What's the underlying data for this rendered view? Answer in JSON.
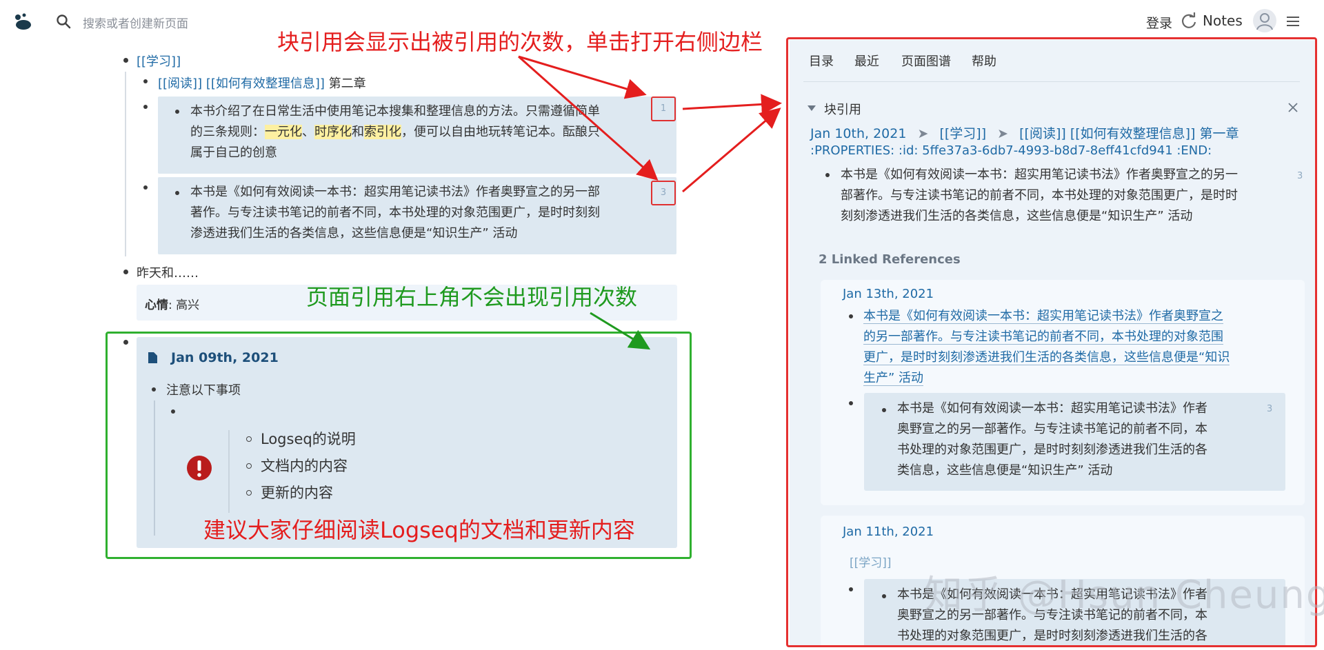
{
  "header": {
    "search_placeholder": "搜索或者创建新页面",
    "login_label": "登录",
    "notes_label": "Notes"
  },
  "main": {
    "study_link": "[[学习]]",
    "reading_link": "[[阅读]]",
    "manage_link": "[[如何有效整理信息]]",
    "chapter2": "第二章",
    "block1_line1": "本书介绍了在日常生活中使用笔记本搜集和整理信息的方法。只需遵循简单",
    "block1_line2_a": "的三条规则：",
    "block1_hl1": "一元化",
    "block1_sep1": "、",
    "block1_hl2": "时序化",
    "block1_and": "和",
    "block1_hl3": "索引化",
    "block1_line2_b": "，便可以自由地玩转笔记本。酝酿只",
    "block1_line3": "属于自己的创意",
    "block1_count": "1",
    "block2_line1": "本书是《如何有效阅读一本书：超实用笔记读书法》作者奥野宣之的另一部",
    "block2_line2": "著作。与专注读书笔记的前者不同，本书处理的对象范围更广，是时时刻刻",
    "block2_line3": "渗透进我们生活的各类信息，这些信息便是“知识生产” 活动",
    "block2_count": "3",
    "yesterday": "昨天和……",
    "mood_key": "心情",
    "mood_value": ": 高兴",
    "embed_title": "Jan 09th, 2021",
    "notice": "注意以下事项",
    "items": [
      "Logseq的说明",
      "文档内的内容",
      "更新的内容"
    ]
  },
  "annotations": {
    "red_top": "块引用会显示出被引用的次数，单击打开右侧边栏",
    "green_mid": "页面引用右上角不会出现引用次数",
    "red_bottom": "建议大家仔细阅读Logseq的文档和更新内容"
  },
  "sidebar": {
    "tabs": [
      "目录",
      "最近",
      "页面图谱",
      "帮助"
    ],
    "block_ref_title": "块引用",
    "breadcrumb_date": "Jan 10th, 2021",
    "breadcrumb_sep": "➤",
    "breadcrumb_study": "[[学习]]",
    "breadcrumb_rest": "[[阅读]] [[如何有效整理信息]] 第一章",
    "properties": ":PROPERTIES: :id: 5ffe37a3-6db7-4993-b8d7-8eff41cfd941 :END:",
    "ref_line1": "本书是《如何有效阅读一本书：超实用笔记读书法》作者奥野宣之的另一",
    "ref_line2": "部著作。与专注读书笔记的前者不同，本书处理的对象范围更广，是时时",
    "ref_line3": "刻刻渗透进我们生活的各类信息，这些信息便是“知识生产” 活动",
    "ref_count": "3",
    "linked_refs": "2 Linked References",
    "card1_date": "Jan 13th, 2021",
    "card1_l1": "本书是《如何有效阅读一本书：超实用笔记读书法》作者奥野宣之",
    "card1_l2": "的另一部著作。与专注读书笔记的前者不同，本书处理的对象范围",
    "card1_l3": "更广，是时时刻刻渗透进我们生活的各类信息，这些信息便是“知识",
    "card1_l4": "生产” 活动",
    "card1_inner_l1": "本书是《如何有效阅读一本书：超实用笔记读书法》作者",
    "card1_inner_l2": "奥野宣之的另一部著作。与专注读书笔记的前者不同，本",
    "card1_inner_l3": "书处理的对象范围更广，是时时刻刻渗透进我们生活的各",
    "card1_inner_l4": "类信息，这些信息便是“知识生产” 活动",
    "card1_count": "3",
    "card2_date": "Jan 11th, 2021",
    "card2_study": "[[学习]]",
    "card2_l1": "本书是《如何有效阅读一本书：超实用笔记读书法》作者",
    "card2_l2": "奥野宣之的另一部著作。与专注读书笔记的前者不同，本",
    "card2_l3": "书处理的对象范围更广，是时时刻刻渗透进我们生活的各"
  },
  "watermark": "知乎 @Hsun Cheung"
}
